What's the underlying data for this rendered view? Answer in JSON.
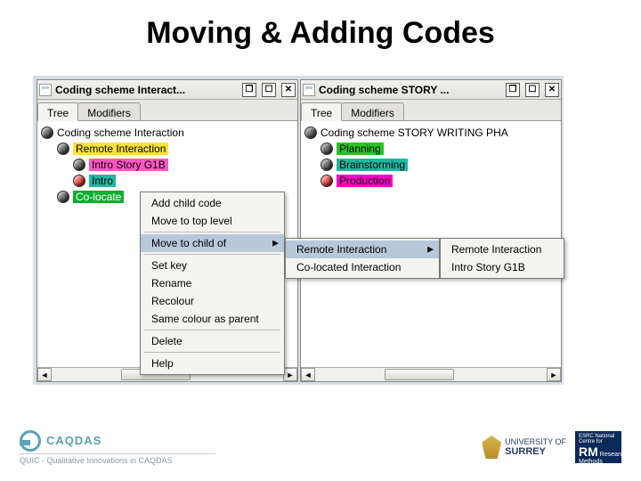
{
  "slide": {
    "title": "Moving & Adding Codes"
  },
  "panels": {
    "left": {
      "title": "Coding scheme Interact...",
      "tabs": {
        "tree": "Tree",
        "modifiers": "Modifiers"
      },
      "root": "Coding scheme Interaction",
      "items": [
        {
          "label": "Remote Interaction",
          "hl": "hl-yellow"
        },
        {
          "label": "Intro Story G1B",
          "hl": "hl-pink"
        },
        {
          "label": "Intro",
          "hl": "hl-teal",
          "selected": true
        },
        {
          "label": "Co-locate",
          "hl": "hl-green"
        }
      ]
    },
    "right": {
      "title": "Coding scheme STORY ...",
      "tabs": {
        "tree": "Tree",
        "modifiers": "Modifiers"
      },
      "root": "Coding scheme STORY WRITING PHA",
      "items": [
        {
          "label": "Planning",
          "hl": "hl-lime"
        },
        {
          "label": "Brainstorming",
          "hl": "hl-teal"
        },
        {
          "label": "Production",
          "hl": "hl-magenta"
        }
      ]
    }
  },
  "context_menu": {
    "items": {
      "add_child": "Add child code",
      "move_top": "Move to top level",
      "move_child_of": "Move to child of",
      "set_key": "Set key",
      "rename": "Rename",
      "recolour": "Recolour",
      "same_colour": "Same colour as parent",
      "delete": "Delete",
      "help": "Help"
    }
  },
  "submenu1": {
    "items": {
      "remote": "Remote Interaction",
      "colocated": "Co-located Interaction"
    }
  },
  "submenu2": {
    "items": {
      "remote": "Remote Interaction",
      "intro_g1b": "Intro Story G1B"
    }
  },
  "window_buttons": {
    "restore": "❐",
    "max": "☐",
    "close": "✕"
  },
  "scrollbar": {
    "left_arrow": "◄",
    "right_arrow": "►"
  },
  "footer": {
    "caqdas": "CAQDAS",
    "quic": "QUIC - Qualitative Innovations in CAQDAS",
    "surrey_line1": "UNIVERSITY OF",
    "surrey_line2": "SURREY",
    "rm_top": "ESRC National Centre for",
    "rm_mid": "Research",
    "rm_big": "RM",
    "rm_bot": "Methods"
  }
}
